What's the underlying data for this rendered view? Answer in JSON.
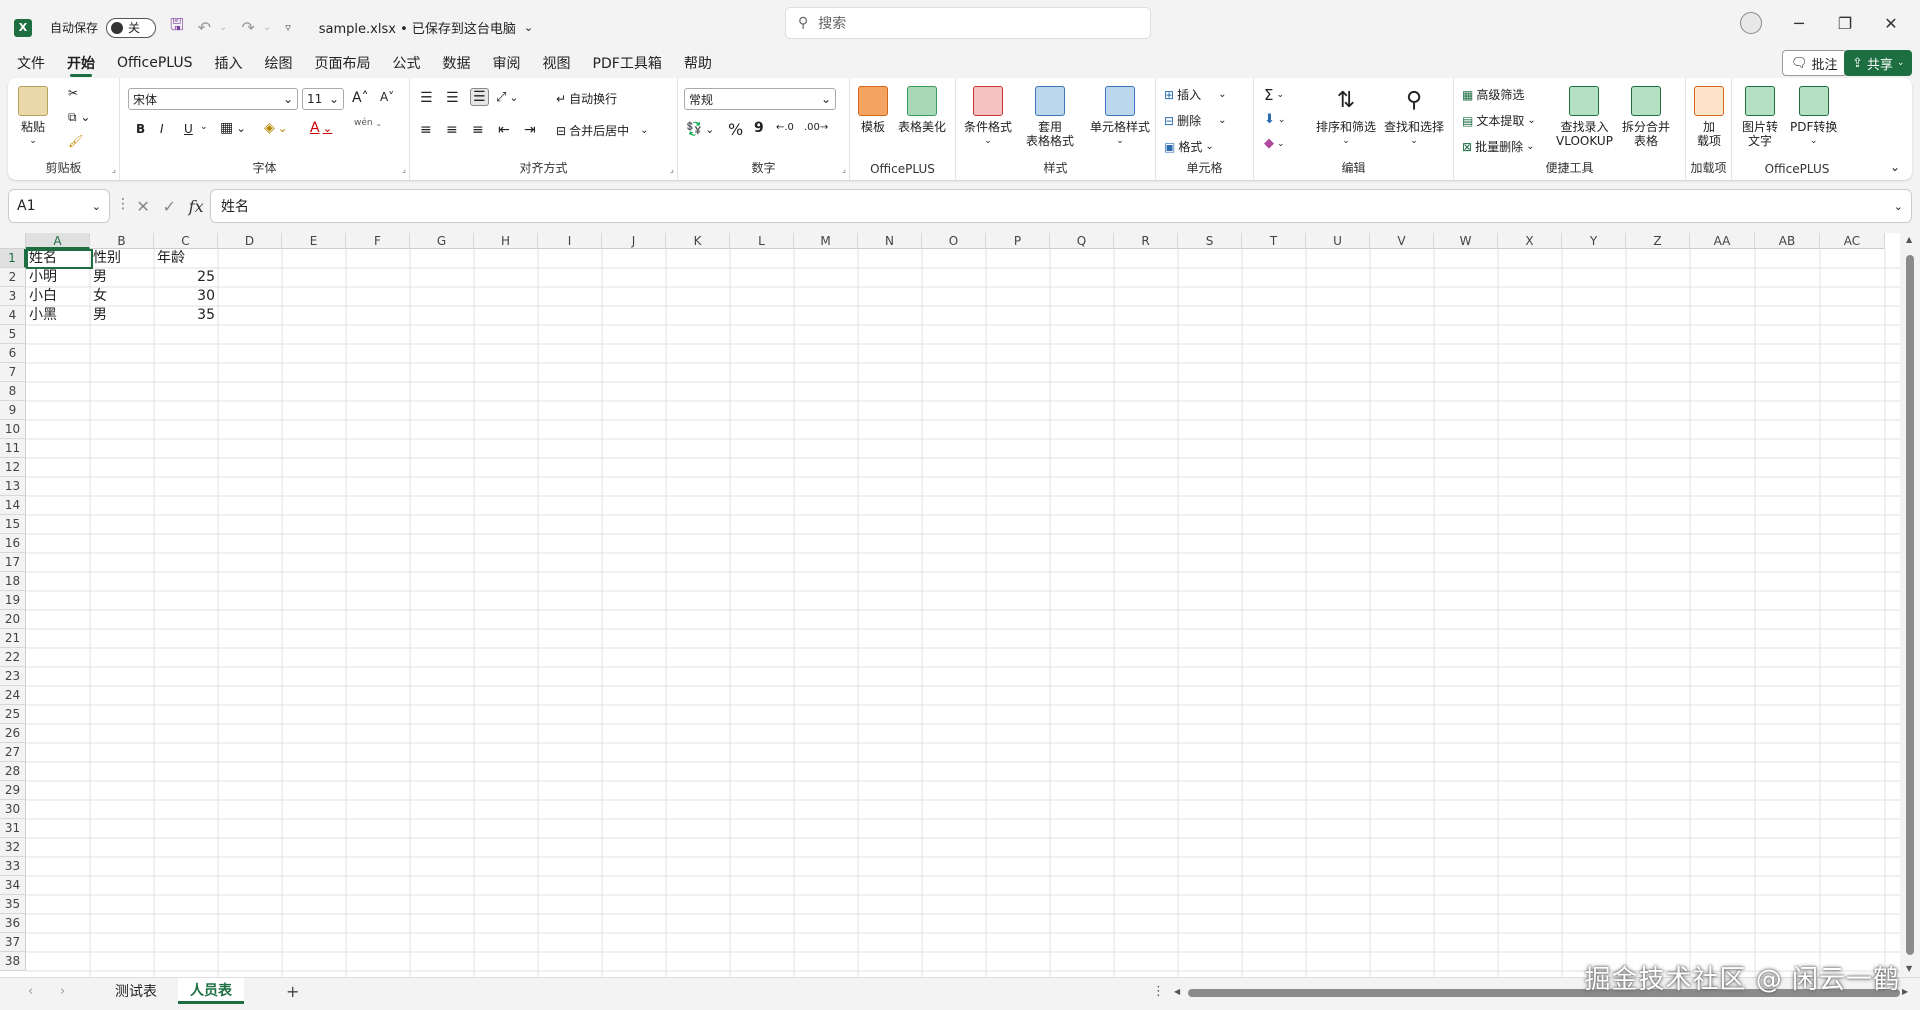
{
  "titlebar": {
    "autosave_label": "自动保存",
    "autosave_state": "关",
    "filename": "sample.xlsx • 已保存到这台电脑",
    "search_placeholder": "搜索"
  },
  "menu": [
    "文件",
    "开始",
    "OfficePLUS",
    "插入",
    "绘图",
    "页面布局",
    "公式",
    "数据",
    "审阅",
    "视图",
    "PDF工具箱",
    "帮助"
  ],
  "menu_active_index": 1,
  "comment_label": "批注",
  "share_label": "共享",
  "ribbon": {
    "clipboard": {
      "paste": "粘贴",
      "label": "剪贴板"
    },
    "font": {
      "font_name": "宋体",
      "font_size": "11",
      "label": "字体",
      "bold": "B",
      "italic": "I",
      "underline": "U",
      "font_color_glyph": "A",
      "wen": "wén"
    },
    "align": {
      "wrap": "自动换行",
      "merge": "合并后居中",
      "label": "对齐方式"
    },
    "number": {
      "format": "常规",
      "percent": "%",
      "comma": "9",
      "label": "数字"
    },
    "officeplus1": {
      "template": "模板",
      "beautify": "表格美化",
      "label": "OfficePLUS"
    },
    "styles": {
      "cond": "条件格式",
      "table1": "套用",
      "table2": "表格格式",
      "cellstyle": "单元格样式",
      "label": "样式"
    },
    "cells": {
      "insert": "插入",
      "delete": "删除",
      "format": "格式",
      "label": "单元格"
    },
    "edit": {
      "sort": "排序和筛选",
      "find": "查找和选择",
      "label": "编辑",
      "sum": "Σ"
    },
    "tools": {
      "adv": "高级筛选",
      "extract": "文本提取",
      "batch": "批量删除",
      "lookup1": "查找录入",
      "lookup2": "VLOOKUP",
      "split1": "拆分合并",
      "split2": "表格",
      "label": "便捷工具"
    },
    "addins": {
      "l1": "加",
      "l2": "载项",
      "label": "加载项"
    },
    "officeplus2": {
      "img1": "图片转",
      "img2": "文字",
      "pdf": "PDF转换",
      "label": "OfficePLUS"
    }
  },
  "namebox": "A1",
  "formula": "姓名",
  "fx": "fx",
  "columns": [
    "A",
    "B",
    "C",
    "D",
    "E",
    "F",
    "G",
    "H",
    "I",
    "J",
    "K",
    "L",
    "M",
    "N",
    "O",
    "P",
    "Q",
    "R",
    "S",
    "T",
    "U",
    "V",
    "W",
    "X",
    "Y",
    "Z",
    "AA",
    "AB",
    "AC"
  ],
  "cells": [
    [
      "姓名",
      "性别",
      "年龄"
    ],
    [
      "小明",
      "男",
      "25"
    ],
    [
      "小白",
      "女",
      "30"
    ],
    [
      "小黑",
      "男",
      "35"
    ]
  ],
  "numeric_columns": [
    2
  ],
  "row_count": 38,
  "sheets": [
    "测试表",
    "人员表"
  ],
  "active_sheet": 1,
  "add_sheet": "+",
  "watermark": "掘金技术社区 @ 闲云一鹤"
}
